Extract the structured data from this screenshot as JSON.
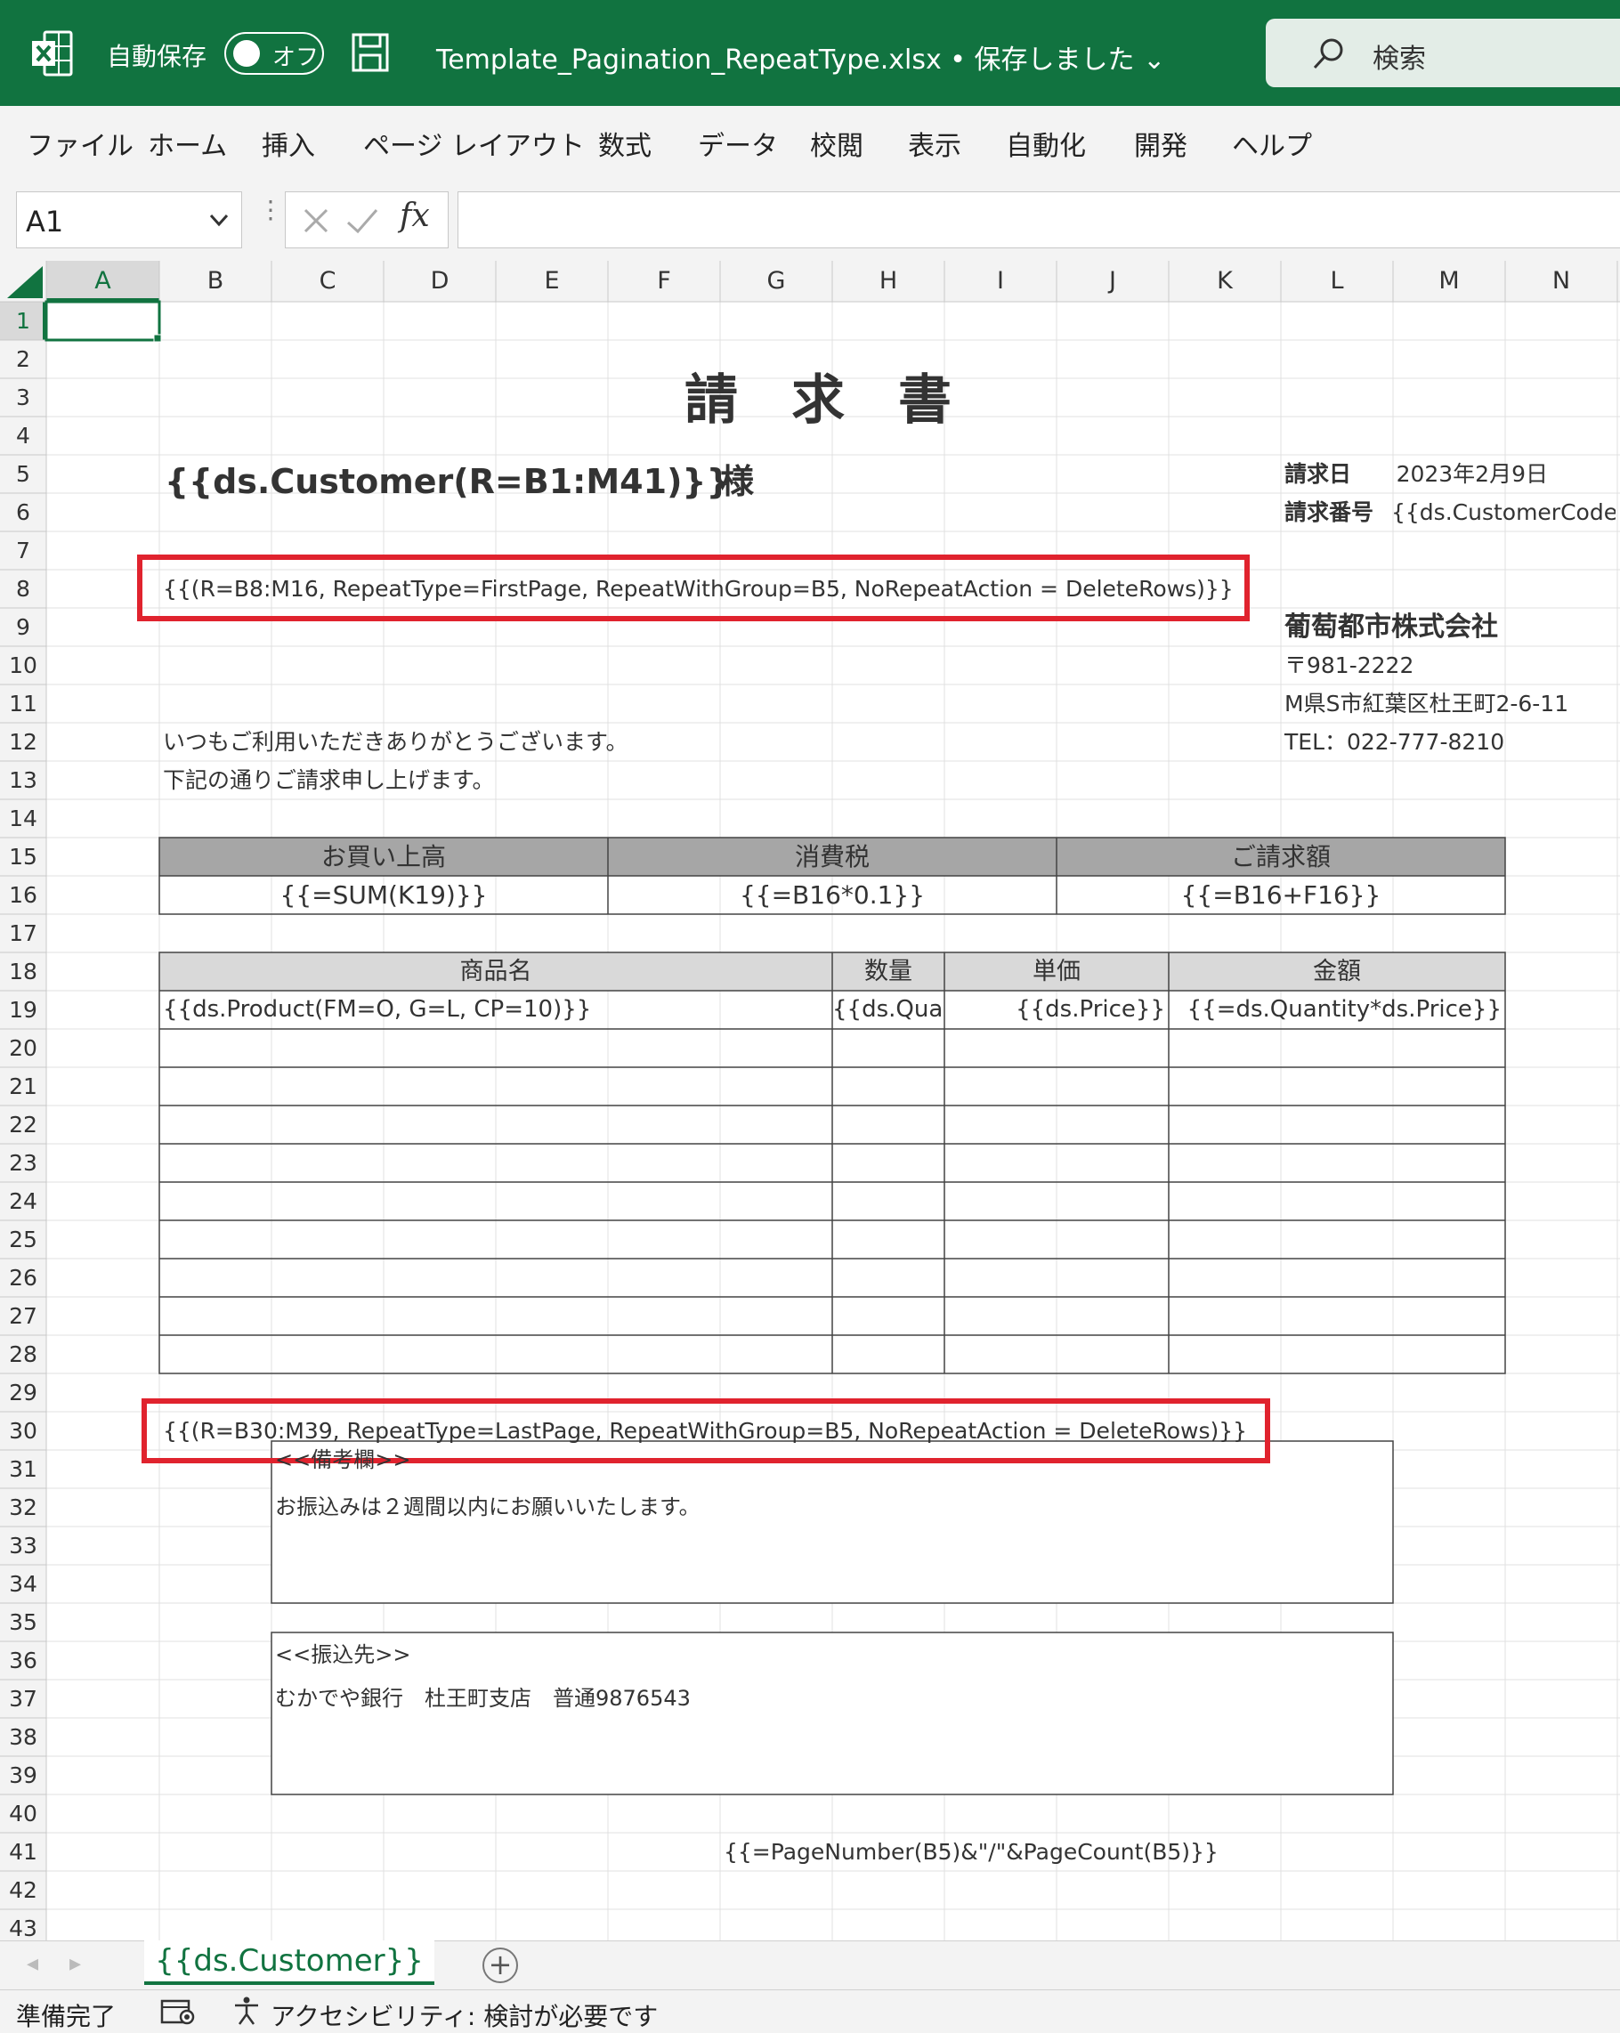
{
  "titlebar": {
    "autosave_label": "自動保存",
    "toggle_label": "オフ",
    "filename": "Template_Pagination_RepeatType.xlsx • 保存しました",
    "search_placeholder": "検索"
  },
  "menu": [
    "ファイル",
    "ホーム",
    "挿入",
    "ページ レイアウト",
    "数式",
    "データ",
    "校閲",
    "表示",
    "自動化",
    "開発",
    "ヘルプ"
  ],
  "formula_bar": {
    "name_box": "A1",
    "formula": ""
  },
  "columns": [
    "A",
    "B",
    "C",
    "D",
    "E",
    "F",
    "G",
    "H",
    "I",
    "J",
    "K",
    "L",
    "M",
    "N"
  ],
  "rows": [
    "1",
    "2",
    "3",
    "4",
    "5",
    "6",
    "7",
    "8",
    "9",
    "10",
    "11",
    "12",
    "13",
    "14",
    "15",
    "16",
    "17",
    "18",
    "19",
    "20",
    "21",
    "22",
    "23",
    "24",
    "25",
    "26",
    "27",
    "28",
    "29",
    "30",
    "31",
    "32",
    "33",
    "34",
    "35",
    "36",
    "37",
    "38",
    "39",
    "40",
    "41",
    "42",
    "43"
  ],
  "selected_cell": "A1",
  "cells": {
    "title": "請　求　書",
    "customer": "{{ds.Customer(R=B1:M41)}}",
    "sama": "様",
    "invoice_date_label": "請求日",
    "invoice_date_value": "2023年2月9日",
    "invoice_no_label": "請求番号",
    "invoice_no_value": "{{ds.CustomerCode}}",
    "repeat_first": "{{(R=B8:M16, RepeatType=FirstPage, RepeatWithGroup=B5, NoRepeatAction = DeleteRows)}}",
    "company_name": "葡萄都市株式会社",
    "postal": "〒981-2222",
    "address": "M県S市紅葉区杜王町2-6-11",
    "tel": "TEL：022-777-8210",
    "greeting1": "いつもご利用いただきありがとうございます。",
    "greeting2": "下記の通りご請求申し上げます。",
    "summary_headers": [
      "お買い上高",
      "消費税",
      "ご請求額"
    ],
    "summary_values": [
      "{{=SUM(K19)}}",
      "{{=B16*0.1}}",
      "{{=B16+F16}}"
    ],
    "detail_headers": [
      "商品名",
      "数量",
      "単価",
      "金額"
    ],
    "detail_row": [
      "{{ds.Product(FM=O, G=L, CP=10)}}",
      "{{ds.Quantity}}",
      "{{ds.Price}}",
      "{{=ds.Quantity*ds.Price}}"
    ],
    "repeat_last": "{{(R=B30:M39, RepeatType=LastPage, RepeatWithGroup=B5, NoRepeatAction = DeleteRows)}}",
    "remarks_title": "<<備考欄>>",
    "remarks_text": "お振込みは２週間以内にお願いいたします。",
    "bank_title": "<<振込先>>",
    "bank_text": "むかでや銀行　杜王町支店　普通9876543",
    "page_number": "{{=PageNumber(B5)&\"/\"&PageCount(B5)}}"
  },
  "sheet_tab": "{{ds.Customer}}",
  "status": {
    "ready": "準備完了",
    "accessibility": "アクセシビリティ: 検討が必要です"
  },
  "colors": {
    "excel_green": "#117340",
    "highlight_red": "#e0232e",
    "header_gray": "#a6a6a6",
    "header_light": "#d9d9d9",
    "gridline": "#e1e1e1"
  }
}
